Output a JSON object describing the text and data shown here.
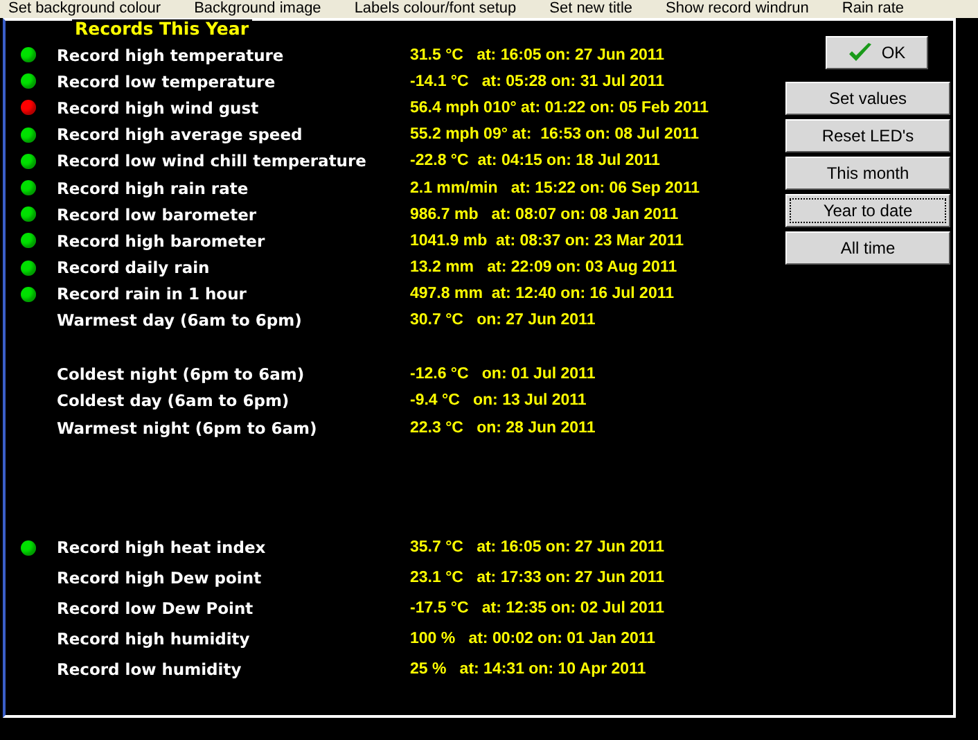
{
  "menu": [
    "Set background colour",
    "Background image",
    "Labels colour/font setup",
    "Set new title",
    "Show record windrun",
    "Rain rate"
  ],
  "title": "Records This Year",
  "groups": [
    [
      {
        "label": "Record high temperature",
        "value": "31.5 °C   at: 16:05 on: 27 Jun 2011",
        "color": "#00e000"
      },
      {
        "label": "Record low temperature",
        "value": "-14.1 °C   at: 05:28 on: 31 Jul 2011",
        "color": "#00e000"
      },
      {
        "label": "Record high wind gust",
        "value": "56.4 mph 010° at: 01:22 on: 05 Feb 2011",
        "color": "#ff0000"
      },
      {
        "label": "Record high average speed",
        "value": "55.2 mph 09° at:  16:53 on: 08 Jul 2011",
        "color": "#00e000"
      },
      {
        "label": "Record low wind chill temperature",
        "value": "-22.8 °C  at: 04:15 on: 18 Jul 2011",
        "color": "#00e000"
      },
      {
        "label": "Record high rain rate",
        "value": "2.1 mm/min   at: 15:22 on: 06 Sep 2011",
        "color": "#00e000"
      },
      {
        "label": "Record low barometer",
        "value": "986.7 mb   at: 08:07 on: 08 Jan 2011",
        "color": "#00e000"
      },
      {
        "label": "Record high barometer",
        "value": "1041.9 mb  at: 08:37 on: 23 Mar 2011",
        "color": "#00e000"
      },
      {
        "label": "Record daily rain",
        "value": "13.2 mm   at: 22:09 on: 03 Aug 2011",
        "color": "#00e000"
      },
      {
        "label": "Record rain in 1 hour",
        "value": "497.8 mm  at: 12:40 on: 16 Jul 2011",
        "color": "#00e000"
      },
      {
        "label": "Warmest day (6am to 6pm)",
        "value": "30.7 °C   on: 27 Jun 2011"
      }
    ],
    [
      {
        "label": "Coldest night (6pm to 6am)",
        "value": "-12.6 °C   on: 01 Jul 2011"
      },
      {
        "label": "Coldest day (6am to 6pm)",
        "value": "-9.4 °C   on: 13 Jul 2011"
      },
      {
        "label": "Warmest night (6pm to 6am)",
        "value": "22.3 °C   on: 28 Jun 2011"
      }
    ],
    [
      {
        "label": "Record high heat index",
        "value": "35.7 °C   at: 16:05 on: 27 Jun 2011",
        "color": "#00e000"
      },
      {
        "label": "Record high Dew point",
        "value": "23.1 °C   at: 17:33 on: 27 Jun 2011"
      },
      {
        "label": "Record low Dew Point",
        "value": "-17.5 °C   at: 12:35 on: 02 Jul 2011"
      },
      {
        "label": "Record high humidity",
        "value": "100 %   at: 00:02 on: 01 Jan 2011"
      },
      {
        "label": "Record low humidity",
        "value": "25 %   at: 14:31 on: 10 Apr 2011"
      }
    ]
  ],
  "ok_button": "OK",
  "buttons": [
    {
      "label": "Set values",
      "focused": false
    },
    {
      "label": "Reset LED's",
      "focused": false
    },
    {
      "label": "This month",
      "focused": false
    },
    {
      "label": "Year to date",
      "focused": true
    },
    {
      "label": "All time",
      "focused": false
    }
  ]
}
